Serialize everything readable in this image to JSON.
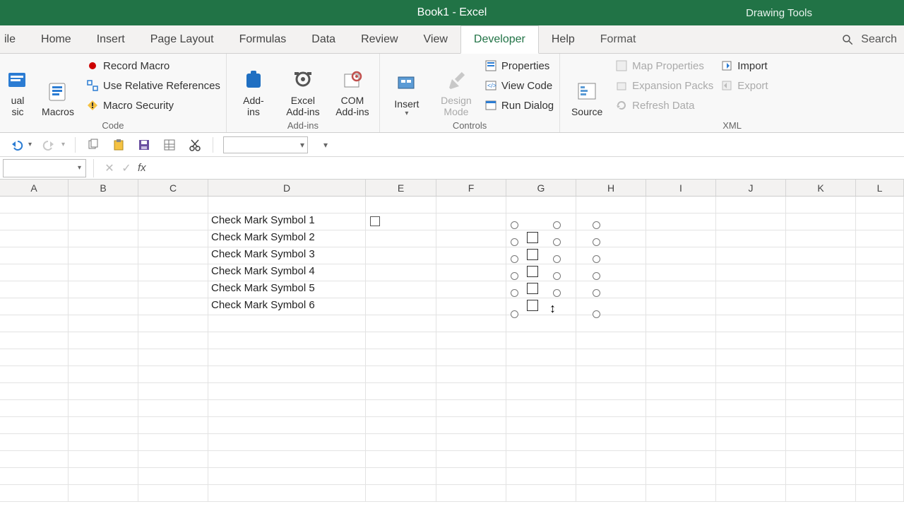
{
  "titlebar": {
    "title": "Book1  -  Excel",
    "contextual": "Drawing Tools"
  },
  "tabs": {
    "file": "ile",
    "items": [
      "Home",
      "Insert",
      "Page Layout",
      "Formulas",
      "Data",
      "Review",
      "View",
      "Developer",
      "Help",
      "Format"
    ],
    "active": "Developer",
    "search_placeholder": "Search"
  },
  "ribbon": {
    "code": {
      "visual_basic": "ual\nsic",
      "macros": "Macros",
      "record_macro": "Record Macro",
      "use_relative": "Use Relative References",
      "macro_security": "Macro Security",
      "label": "Code"
    },
    "addins": {
      "addins": "Add-\nins",
      "excel_addins": "Excel\nAdd-ins",
      "com_addins": "COM\nAdd-ins",
      "label": "Add-ins"
    },
    "controls": {
      "insert": "Insert",
      "design_mode": "Design\nMode",
      "properties": "Properties",
      "view_code": "View Code",
      "run_dialog": "Run Dialog",
      "label": "Controls"
    },
    "xml": {
      "source": "Source",
      "map_properties": "Map Properties",
      "expansion_packs": "Expansion Packs",
      "refresh_data": "Refresh Data",
      "import": "Import",
      "export": "Export",
      "label": "XML"
    }
  },
  "fx": {
    "name_box": "",
    "formula": ""
  },
  "columns": [
    "A",
    "B",
    "C",
    "D",
    "E",
    "F",
    "G",
    "H",
    "I",
    "J",
    "K",
    "L"
  ],
  "cells": {
    "D": [
      "Check Mark Symbol 1",
      "Check Mark Symbol 2",
      "Check Mark Symbol 3",
      "Check Mark Symbol 4",
      "Check Mark Symbol 5",
      "Check Mark Symbol 6"
    ]
  }
}
